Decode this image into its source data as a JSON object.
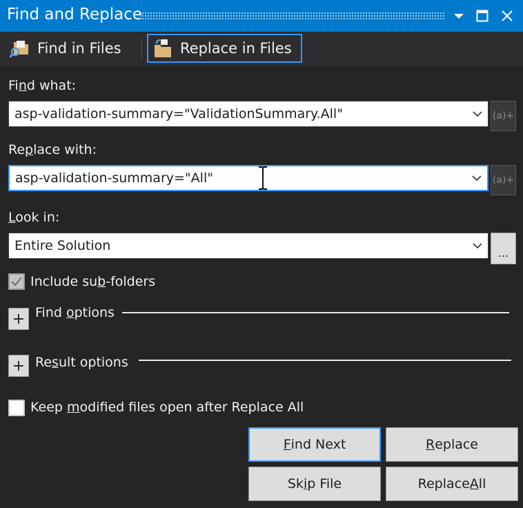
{
  "window": {
    "title": "Find and Replace",
    "accent_color": "#007acc",
    "background_color": "#252526"
  },
  "tabs": [
    {
      "label": "Find in Files",
      "icon": "find-in-files-icon",
      "selected": false
    },
    {
      "label": "Replace in Files",
      "icon": "replace-in-files-icon",
      "selected": true
    }
  ],
  "find_what": {
    "label_pre": "Fi",
    "label_u": "n",
    "label_post": "d what:",
    "value": "asp-validation-summary=\"ValidationSummary.All\""
  },
  "replace_with": {
    "label_pre": "Re",
    "label_u": "p",
    "label_post": "lace with:",
    "value": "asp-validation-summary=\"All\""
  },
  "look_in": {
    "label_pre": "",
    "label_u": "L",
    "label_post": "ook in:",
    "value": "Entire Solution",
    "browse_label": "..."
  },
  "regex_builder_label": "(a)+",
  "include_subfolders": {
    "label_pre": "Include su",
    "label_u": "b",
    "label_post": "-folders",
    "checked": true,
    "disabled": true
  },
  "find_options": {
    "label_pre": "Find ",
    "label_u": "o",
    "label_post": "ptions",
    "expander": "+"
  },
  "result_options": {
    "label_pre": "Re",
    "label_u": "s",
    "label_post": "ult options",
    "expander": "+"
  },
  "keep_open": {
    "label_pre": "Keep ",
    "label_u": "m",
    "label_post": "odified files open after Replace All",
    "checked": false
  },
  "buttons": {
    "find_next": {
      "u": "F",
      "post": "ind Next"
    },
    "replace": {
      "u": "R",
      "post": "eplace"
    },
    "skip_file": {
      "pre": "Sk",
      "u": "i",
      "post": "p File"
    },
    "replace_all": {
      "pre": "Replace ",
      "u": "A",
      "post": "ll"
    }
  }
}
